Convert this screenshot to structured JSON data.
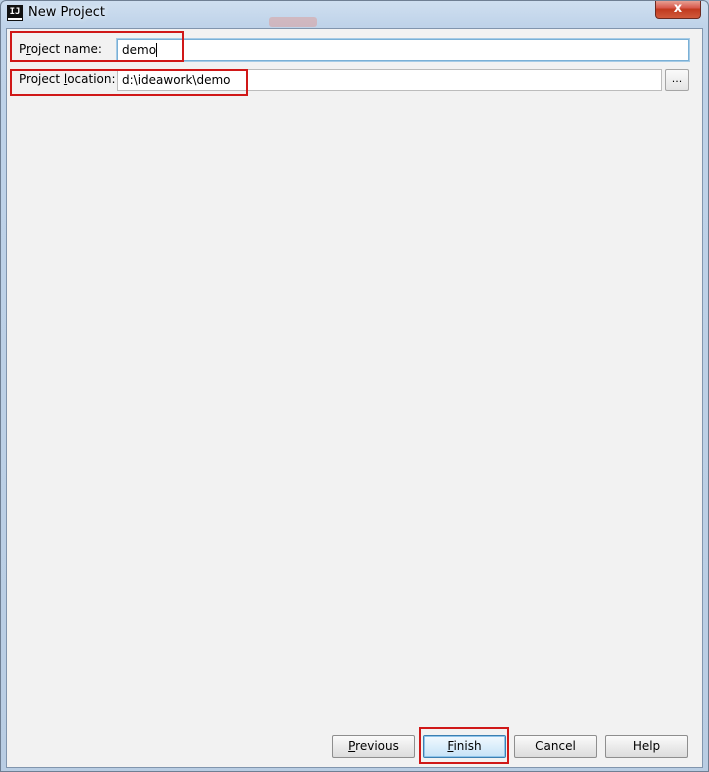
{
  "window": {
    "title": "New Project",
    "app_icon_text": "IJ",
    "close_label": "x"
  },
  "form": {
    "name": {
      "label": "Project name:",
      "value": "demo"
    },
    "location": {
      "label": "Project location:",
      "value": "d:\\ideawork\\demo",
      "browse_label": "..."
    }
  },
  "footer": {
    "previous_label": "Previous",
    "finish_label": "Finish",
    "cancel_label": "Cancel",
    "help_label": "Help"
  },
  "colors": {
    "annotation_border": "#d01818",
    "client_background": "#f2f2f2",
    "focus_border": "#7ab0d6"
  },
  "icons": {
    "app": "intellij-idea-icon",
    "close": "close-icon",
    "browse": "ellipsis-icon"
  }
}
